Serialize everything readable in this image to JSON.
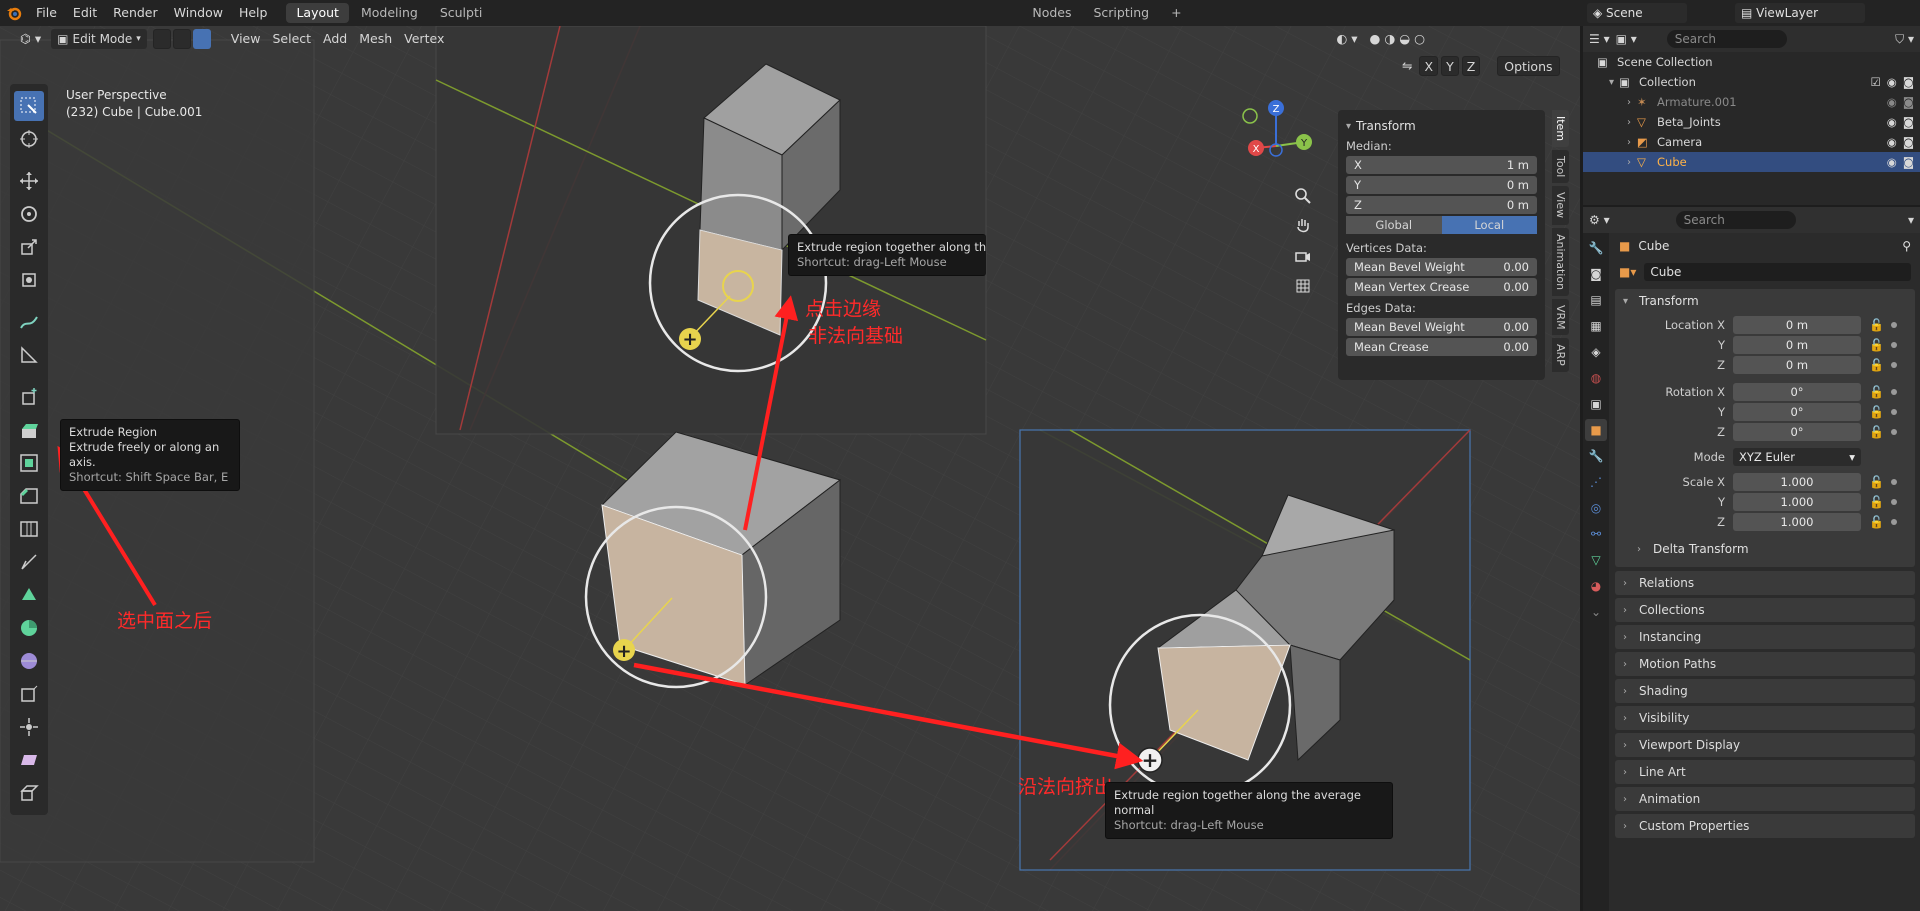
{
  "colors": {
    "accent": "#4772b3",
    "annotation_red": "#ff2a2a",
    "gizmo_yellow": "#e8d44d",
    "viewport_bg": "#393939"
  },
  "topbar": {
    "menus": [
      "File",
      "Edit",
      "Render",
      "Window",
      "Help"
    ],
    "workspaces": [
      "Layout",
      "Modeling",
      "Sculpti",
      "Nodes",
      "Scripting"
    ],
    "active_workspace": "Layout",
    "add_workspace": "+"
  },
  "viewport_header": {
    "mode": "Edit Mode",
    "menus": [
      "View",
      "Select",
      "Add",
      "Mesh",
      "Vertex"
    ],
    "axis_x": "X",
    "axis_y": "Y",
    "axis_z": "Z",
    "options": "Options"
  },
  "overlay": {
    "perspective": "User Perspective",
    "object_info": "(232) Cube | Cube.001"
  },
  "tooltips": {
    "extrude_region": {
      "title": "Extrude Region",
      "desc": "Extrude freely or along an axis.",
      "shortcut": "Shortcut: Shift Space Bar, E"
    },
    "extrude_normal_top": {
      "title": "Extrude region together along the a",
      "shortcut": "Shortcut: drag-Left Mouse"
    },
    "extrude_normal_bottom": {
      "title": "Extrude region together along the average normal",
      "shortcut": "Shortcut: drag-Left Mouse"
    }
  },
  "annotations": {
    "after_select": "选中面之后",
    "click_edge_1": "点击边缘",
    "click_edge_2": "非法向基础",
    "extrude_normal": "沿法向挤出"
  },
  "npanel": {
    "title": "Transform",
    "median": "Median:",
    "x_label": "X",
    "x_val": "1 m",
    "y_label": "Y",
    "y_val": "0 m",
    "z_label": "Z",
    "z_val": "0 m",
    "global": "Global",
    "local": "Local",
    "vertices_data": "Vertices Data:",
    "mean_bevel_weight": "Mean Bevel Weight",
    "mean_bevel_weight_val": "0.00",
    "mean_vertex_crease": "Mean Vertex Crease",
    "mean_vertex_crease_val": "0.00",
    "edges_data": "Edges Data:",
    "edge_bevel_weight": "Mean Bevel Weight",
    "edge_bevel_weight_val": "0.00",
    "mean_crease": "Mean Crease",
    "mean_crease_val": "0.00",
    "tabs": [
      "Item",
      "Tool",
      "View",
      "Animation",
      "VRM",
      "ARP"
    ]
  },
  "scene_bar": {
    "scene": "Scene",
    "view_layer": "ViewLayer"
  },
  "outliner": {
    "search_placeholder": "Search",
    "scene_collection": "Scene Collection",
    "collection": "Collection",
    "items": [
      {
        "name": "Armature.001"
      },
      {
        "name": "Beta_Joints"
      },
      {
        "name": "Camera"
      },
      {
        "name": "Cube"
      }
    ]
  },
  "properties": {
    "search_placeholder": "Search",
    "object_name": "Cube",
    "object_field": "Cube",
    "transform": "Transform",
    "location_x_label": "Location X",
    "location_x": "0 m",
    "location_y_label": "Y",
    "location_y": "0 m",
    "location_z_label": "Z",
    "location_z": "0 m",
    "rotation_x_label": "Rotation X",
    "rotation_x": "0°",
    "rotation_y_label": "Y",
    "rotation_y": "0°",
    "rotation_z_label": "Z",
    "rotation_z": "0°",
    "mode_label": "Mode",
    "mode_value": "XYZ Euler",
    "scale_x_label": "Scale X",
    "scale_x": "1.000",
    "scale_y_label": "Y",
    "scale_y": "1.000",
    "scale_z_label": "Z",
    "scale_z": "1.000",
    "delta_transform": "Delta Transform",
    "panels": [
      "Relations",
      "Collections",
      "Instancing",
      "Motion Paths",
      "Shading",
      "Visibility",
      "Viewport Display",
      "Line Art",
      "Animation",
      "Custom Properties"
    ]
  }
}
